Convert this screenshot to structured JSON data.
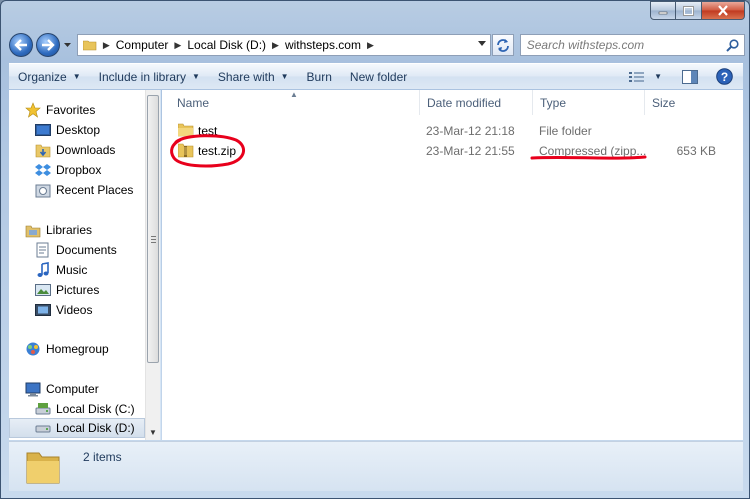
{
  "window": {
    "caption_buttons": {
      "minimize": "minimize-icon",
      "maximize": "maximize-icon",
      "close": "close-icon"
    }
  },
  "address_bar": {
    "breadcrumbs": [
      "Computer",
      "Local Disk (D:)",
      "withsteps.com"
    ],
    "search_placeholder": "Search withsteps.com"
  },
  "toolbar": {
    "organize": "Organize",
    "include_in_library": "Include in library",
    "share_with": "Share with",
    "burn": "Burn",
    "new_folder": "New folder"
  },
  "navigation": {
    "favorites_header": "Favorites",
    "favorites": [
      "Desktop",
      "Downloads",
      "Dropbox",
      "Recent Places"
    ],
    "libraries_header": "Libraries",
    "libraries": [
      "Documents",
      "Music",
      "Pictures",
      "Videos"
    ],
    "homegroup": "Homegroup",
    "computer_header": "Computer",
    "drives": [
      "Local Disk (C:)",
      "Local Disk (D:)"
    ]
  },
  "columns": {
    "name": "Name",
    "date_modified": "Date modified",
    "type": "Type",
    "size": "Size"
  },
  "files": [
    {
      "name": "test",
      "date": "23-Mar-12 21:18",
      "type": "File folder",
      "size": ""
    },
    {
      "name": "test.zip",
      "date": "23-Mar-12 21:55",
      "type": "Compressed (zipp...",
      "size": "653 KB"
    }
  ],
  "status": {
    "count": "2 items"
  },
  "colors": {
    "annotation": "#e8001c",
    "accent": "#1e395b"
  }
}
